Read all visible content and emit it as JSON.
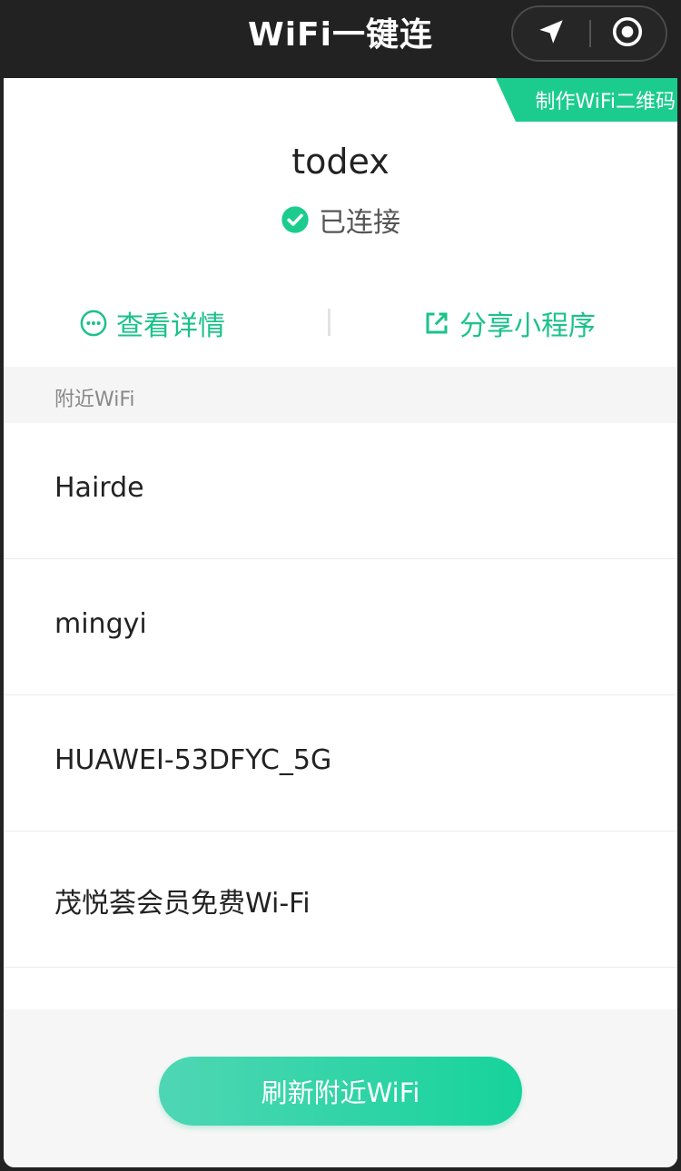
{
  "nav": {
    "title": "WiFi一键连",
    "capsule_left_icon": "location-arrow-icon",
    "capsule_right_icon": "record-target-icon"
  },
  "ribbon": {
    "label": "制作WiFi二维码"
  },
  "current": {
    "ssid": "todex",
    "status": "已连接",
    "status_icon": "check-circle-icon"
  },
  "actions": {
    "details_label": "查看详情",
    "details_icon": "more-circle-icon",
    "share_label": "分享小程序",
    "share_icon": "external-share-icon"
  },
  "nearby": {
    "header": "附近WiFi",
    "networks": [
      {
        "ssid": "Hairde"
      },
      {
        "ssid": "mingyi"
      },
      {
        "ssid": "HUAWEI-53DFYC_5G"
      },
      {
        "ssid": "茂悦荟会员免费Wi-Fi"
      }
    ]
  },
  "refresh_button": {
    "label": "刷新附近WiFi"
  },
  "colors": {
    "accent": "#1ccc8f",
    "nav_bg": "#222222",
    "section_bg": "#f5f5f5"
  }
}
